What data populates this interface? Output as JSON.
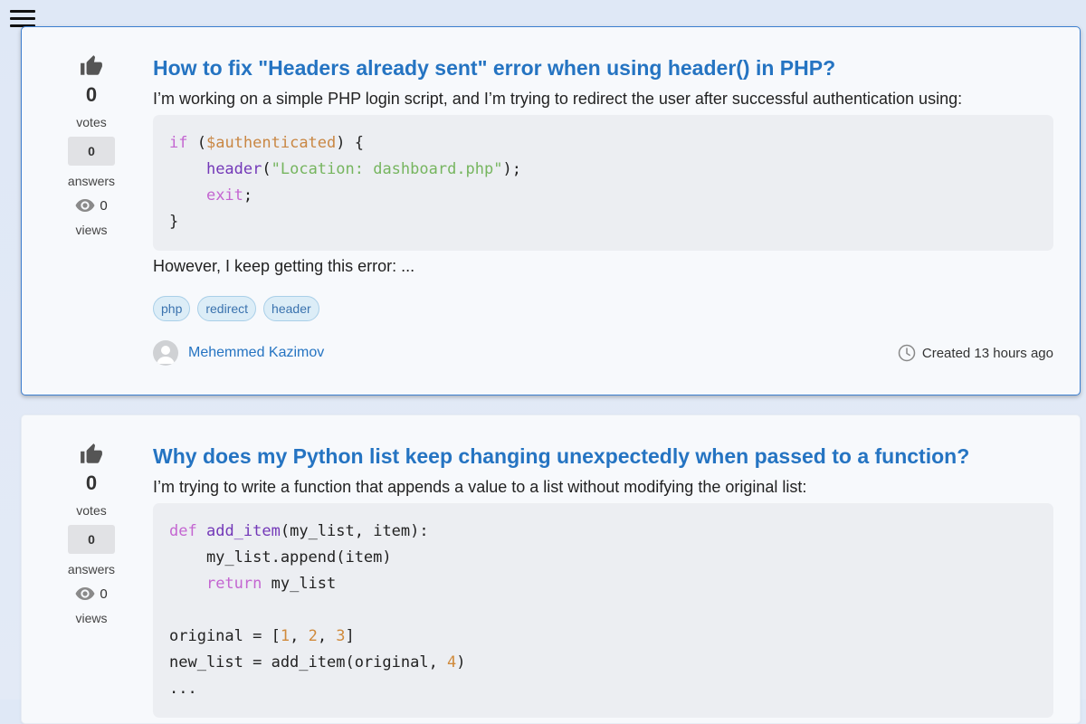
{
  "header": {
    "menu_icon": "hamburger-menu-icon"
  },
  "questions": [
    {
      "title": "How to fix \"Headers already sent\" error when using header() in PHP?",
      "excerpt": "I’m working on a simple PHP login script, and I’m trying to redirect the user after successful authentication using:",
      "code": [
        [
          {
            "t": "if",
            "c": "kw"
          },
          {
            "t": " ("
          },
          {
            "t": "$authenticated",
            "c": "var"
          },
          {
            "t": ") {"
          }
        ],
        [
          {
            "t": "    "
          },
          {
            "t": "header",
            "c": "fn"
          },
          {
            "t": "("
          },
          {
            "t": "\"Location: dashboard.php\"",
            "c": "str"
          },
          {
            "t": ");"
          }
        ],
        [
          {
            "t": "    "
          },
          {
            "t": "exit",
            "c": "kw"
          },
          {
            "t": ";"
          }
        ],
        [
          {
            "t": "}"
          }
        ]
      ],
      "more": "However, I keep getting this error: ...",
      "votes": "0",
      "votes_label": "votes",
      "answers": "0",
      "answers_label": "answers",
      "views": "0",
      "views_label": "views",
      "tags": [
        "php",
        "redirect",
        "header"
      ],
      "author": "Mehemmed Kazimov",
      "created": "Created 13 hours ago"
    },
    {
      "title": "Why does my Python list keep changing unexpectedly when passed to a function?",
      "excerpt": "I’m trying to write a function that appends a value to a list without modifying the original list:",
      "code": [
        [
          {
            "t": "def",
            "c": "kw"
          },
          {
            "t": " "
          },
          {
            "t": "add_item",
            "c": "fn"
          },
          {
            "t": "(my_list, item):"
          }
        ],
        [
          {
            "t": "    my_list.append(item)"
          }
        ],
        [
          {
            "t": "    "
          },
          {
            "t": "return",
            "c": "kw"
          },
          {
            "t": " my_list"
          }
        ],
        [
          {
            "t": ""
          }
        ],
        [
          {
            "t": "original = ["
          },
          {
            "t": "1",
            "c": "num"
          },
          {
            "t": ", "
          },
          {
            "t": "2",
            "c": "num"
          },
          {
            "t": ", "
          },
          {
            "t": "3",
            "c": "num"
          },
          {
            "t": "]"
          }
        ],
        [
          {
            "t": "new_list = add_item(original, "
          },
          {
            "t": "4",
            "c": "num"
          },
          {
            "t": ")"
          }
        ],
        [
          {
            "t": "..."
          }
        ]
      ],
      "votes": "0",
      "votes_label": "votes",
      "answers": "0",
      "answers_label": "answers",
      "views": "0",
      "views_label": "views"
    }
  ],
  "icons": {
    "vote": "thumbs-up-icon",
    "views": "eye-icon",
    "avatar": "user-avatar-icon",
    "created": "clock-icon"
  },
  "colors": {
    "link": "#2574c2",
    "active_border": "#3d7fcf",
    "code_bg": "#eceef2",
    "tag_bg": "#dcedf7",
    "keyword": "#c466d1",
    "function": "#7338b8",
    "variable": "#c98744",
    "string": "#76b55f",
    "number": "#d08a3c"
  }
}
